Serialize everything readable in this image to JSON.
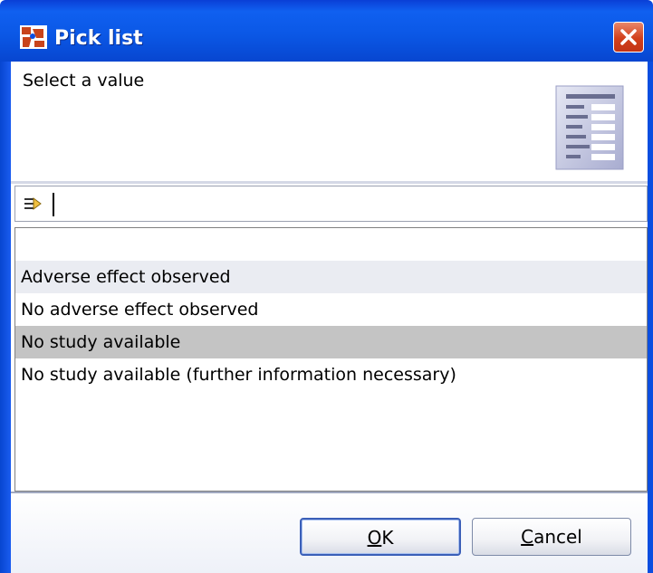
{
  "window": {
    "title": "Pick list"
  },
  "header": {
    "prompt": "Select a value"
  },
  "filter": {
    "value": ""
  },
  "list": {
    "items": [
      {
        "label": ""
      },
      {
        "label": "Adverse effect observed"
      },
      {
        "label": "No adverse effect observed"
      },
      {
        "label": "No study available"
      },
      {
        "label": "No study available (further information necessary)"
      }
    ],
    "selected_index": 3,
    "highlighted_index": 1
  },
  "buttons": {
    "ok": {
      "mnemonic": "O",
      "rest": "K"
    },
    "cancel": {
      "mnemonic": "C",
      "rest": "ancel"
    }
  },
  "colors": {
    "selected_row": "#c4c4c4",
    "alt_row": "#eaecf2",
    "titlebar": "#0b58e6",
    "close": "#d2401b"
  },
  "icons": {
    "app": "app-logo-icon",
    "close": "close-icon",
    "header": "document-form-icon",
    "filter": "filter-arrow-icon"
  }
}
